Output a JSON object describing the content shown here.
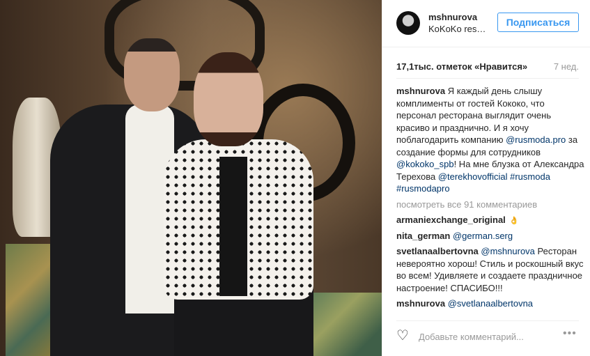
{
  "post": {
    "image_alt": "",
    "header": {
      "username": "mshnurova",
      "location": "KoKoKo restaurant",
      "follow_label": "Подписаться"
    },
    "likes": "17,1тыс. отметок «Нравится»",
    "age": "7 нед.",
    "caption": {
      "username": "mshnurova",
      "text_1": "Я каждый день слышу комплименты от гостей Кококо, что персонал ресторана выглядит очень красиво и празднично. И я хочу поблагодарить компанию ",
      "tag_1": "@rusmoda.pro",
      "text_2": " за создание формы для сотрудников ",
      "tag_2": "@kokoko_spb",
      "text_3": "! На мне блузка от Александра Терехова ",
      "tag_3": "@terekhovofficial",
      "tag_4": "#rusmoda",
      "tag_5": "#rusmodapro"
    },
    "view_all": "посмотреть все 91 комментариев",
    "comments": [
      {
        "user": "armaniexchange_original",
        "text": "",
        "emoji": "👌"
      },
      {
        "user": "nita_german",
        "mention": "@german.serg",
        "text": ""
      },
      {
        "user": "svetlanaalbertovna",
        "mention": "@mshnurova",
        "text": "Ресторан невероятно хорош! Стиль и роскошный вкус во всем! Удивляете и создаете праздничное настроение! СПАСИБО!!!"
      },
      {
        "user": "mshnurova",
        "mention": "@svetlanaalbertovna",
        "text": ""
      }
    ],
    "add_comment_placeholder": "Добавьте комментарий...",
    "icons": {
      "like": "heart-icon",
      "options": "more-options-icon"
    }
  }
}
